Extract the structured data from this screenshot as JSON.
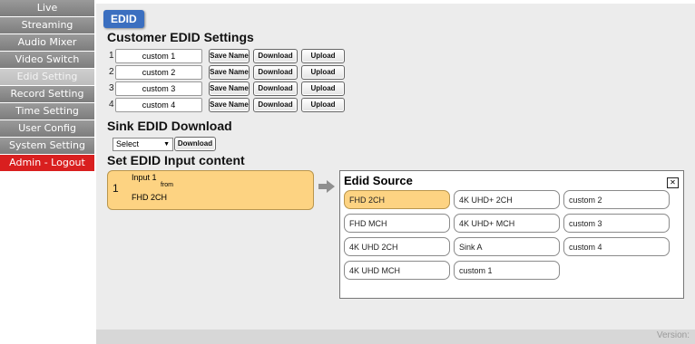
{
  "sidebar": {
    "items": [
      {
        "label": "Live"
      },
      {
        "label": "Streaming"
      },
      {
        "label": "Audio Mixer"
      },
      {
        "label": "Video Switch"
      },
      {
        "label": "Edid Setting"
      },
      {
        "label": "Record Setting"
      },
      {
        "label": "Time Setting"
      },
      {
        "label": "User Config"
      },
      {
        "label": "System Setting"
      },
      {
        "label": "Admin - Logout"
      }
    ],
    "active_index": 4
  },
  "tab": {
    "label": "EDID"
  },
  "customer_edid": {
    "title": "Customer EDID Settings",
    "rows": [
      {
        "num": "1",
        "name": "custom 1"
      },
      {
        "num": "2",
        "name": "custom 2"
      },
      {
        "num": "3",
        "name": "custom 3"
      },
      {
        "num": "4",
        "name": "custom 4"
      }
    ],
    "save_label": "Save Name",
    "download_label": "Download",
    "upload_label": "Upload"
  },
  "sink_edid": {
    "title": "Sink EDID Download",
    "select_value": "Select",
    "download_label": "Download"
  },
  "set_edid": {
    "title": "Set EDID Input content",
    "input_label": "Input 1",
    "input_number": "1",
    "from_label": "from",
    "current_source": "FHD 2CH"
  },
  "edid_source": {
    "title": "Edid Source",
    "close_icon": "close-icon",
    "columns": [
      [
        "FHD 2CH",
        "FHD MCH",
        "4K UHD 2CH",
        "4K UHD MCH"
      ],
      [
        "4K UHD+ 2CH",
        "4K UHD+ MCH",
        "Sink A",
        "custom 1"
      ],
      [
        "custom 2",
        "custom 3",
        "custom 4"
      ]
    ],
    "selected": "FHD 2CH"
  },
  "footer": {
    "version_label": "Version:"
  },
  "colors": {
    "sidebar_gray": "#8c8c8c",
    "active": "#c4c4c4",
    "logout": "#d91f1f",
    "tab_blue": "#3b6fc0",
    "highlight": "#fdd382"
  }
}
